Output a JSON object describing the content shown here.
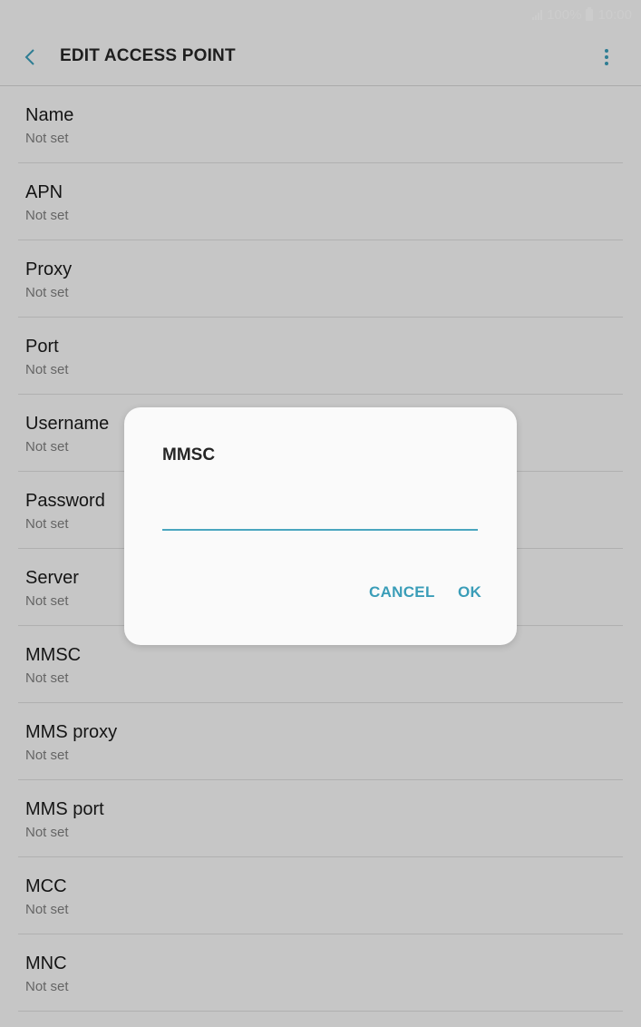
{
  "status_bar": {
    "battery": "100%",
    "time": "10:00"
  },
  "header": {
    "title": "EDIT ACCESS POINT",
    "back_icon": "chevron-left-icon",
    "more_icon": "more-vert-icon"
  },
  "list": {
    "items": [
      {
        "label": "Name",
        "value": "Not set"
      },
      {
        "label": "APN",
        "value": "Not set"
      },
      {
        "label": "Proxy",
        "value": "Not set"
      },
      {
        "label": "Port",
        "value": "Not set"
      },
      {
        "label": "Username",
        "value": "Not set"
      },
      {
        "label": "Password",
        "value": "Not set"
      },
      {
        "label": "Server",
        "value": "Not set"
      },
      {
        "label": "MMSC",
        "value": "Not set"
      },
      {
        "label": "MMS proxy",
        "value": "Not set"
      },
      {
        "label": "MMS port",
        "value": "Not set"
      },
      {
        "label": "MCC",
        "value": "Not set"
      },
      {
        "label": "MNC",
        "value": "Not set"
      }
    ]
  },
  "dialog": {
    "title": "MMSC",
    "input_value": "",
    "cancel_label": "CANCEL",
    "ok_label": "OK"
  },
  "colors": {
    "accent": "#3a9db8",
    "input_underline": "#4aa6bf",
    "scrim": "rgba(0,0,0,0.2)"
  }
}
